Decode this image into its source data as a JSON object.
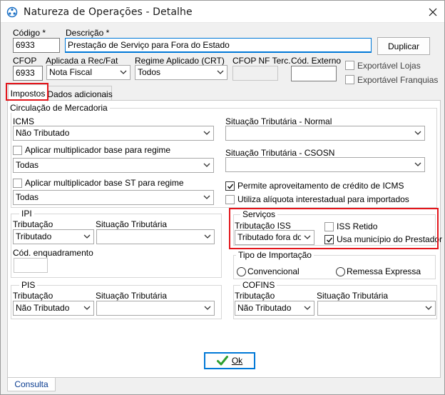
{
  "window": {
    "title": "Natureza de Operações - Detalhe",
    "close_glyph": "✕"
  },
  "header": {
    "codigo_label": "Código *",
    "codigo_value": "6933",
    "descricao_label": "Descrição *",
    "descricao_value": "Prestação de Serviço para Fora do Estado",
    "duplicar_label": "Duplicar",
    "cfop_label": "CFOP",
    "cfop_value": "6933",
    "aplicada_label": "Aplicada a Rec/Fat",
    "aplicada_value": "Nota Fiscal",
    "regime_label": "Regime Aplicado (CRT)",
    "regime_value": "Todos",
    "cfop_nf_label": "CFOP NF Terc.",
    "cfop_nf_value": "",
    "cod_externo_label": "Cód. Externo",
    "cod_externo_value": "",
    "exportavel_lojas_label": "Exportável Lojas",
    "exportavel_franquias_label": "Exportável Franquias"
  },
  "tabs": [
    {
      "label": "Impostos"
    },
    {
      "label": "Dados adicionais"
    }
  ],
  "mercadoria": {
    "title": "Circulação de Mercadoria",
    "icms_label": "ICMS",
    "icms_value": "Não Tributado",
    "mult_label": "Aplicar multiplicador base para regime",
    "mult_value": "Todas",
    "mult_st_label": "Aplicar multiplicador base ST para regime",
    "mult_st_value": "Todas",
    "sit_normal_label": "Situação Tributária - Normal",
    "sit_normal_value": "",
    "sit_csosn_label": "Situação Tributária - CSOSN",
    "sit_csosn_value": "",
    "credito_label": "Permite aproveitamento de crédito de ICMS",
    "aliquota_label": "Utiliza alíquota interestadual para importados"
  },
  "ipi": {
    "title": "IPI",
    "tributacao_label": "Tributação",
    "tributacao_value": "Tributado",
    "situacao_label": "Situação Tributária",
    "situacao_value": "",
    "cod_enq_label": "Cód. enquadramento",
    "cod_enq_value": ""
  },
  "servicos": {
    "title": "Serviços",
    "tributacao_label": "Tributação ISS",
    "tributacao_value": "Tributado fora do município",
    "iss_retido_label": "ISS Retido",
    "usa_municipio_label": "Usa município do Prestador"
  },
  "importacao": {
    "title": "Tipo de Importação",
    "convencional_label": "Convencional",
    "remessa_label": "Remessa Expressa"
  },
  "pis": {
    "title": "PIS",
    "tributacao_label": "Tributação",
    "tributacao_value": "Não Tributado",
    "situacao_label": "Situação Tributária",
    "situacao_value": ""
  },
  "cofins": {
    "title": "COFINS",
    "tributacao_label": "Tributação",
    "tributacao_value": "Não Tributado",
    "situacao_label": "Situação Tributária",
    "situacao_value": ""
  },
  "footer": {
    "ok_label": "Ok",
    "status_tab": "Consulta"
  },
  "colors": {
    "highlight": "#e3161c",
    "accent": "#0078d7",
    "ok_check": "#2e9e2e"
  }
}
